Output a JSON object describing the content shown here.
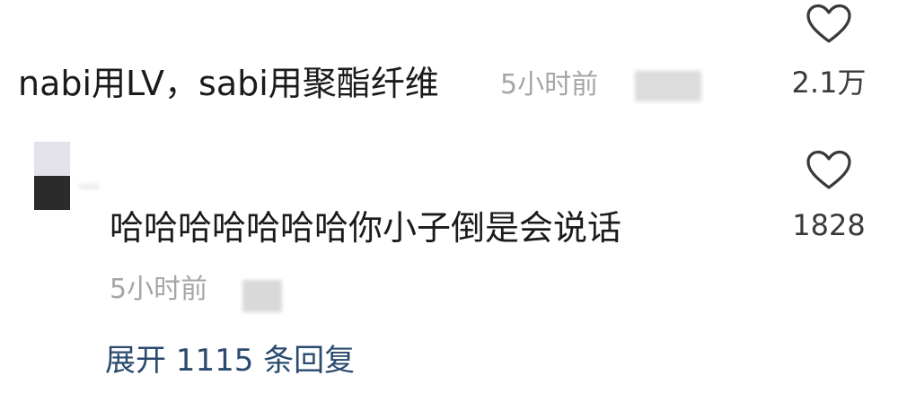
{
  "comments": [
    {
      "text": "nabi用LV，sabi用聚酯纤维",
      "time": "5小时前",
      "likes": "2.1万"
    }
  ],
  "reply": {
    "text": "哈哈哈哈哈哈哈你小子倒是会说话",
    "time": "5小时前",
    "likes": "1828"
  },
  "expand_label": "展开 1115 条回复",
  "icons": {
    "like": "heart-outline-icon"
  },
  "colors": {
    "text": "#1b1b1b",
    "muted": "#a6a6a6",
    "link": "#2a4a6e"
  }
}
